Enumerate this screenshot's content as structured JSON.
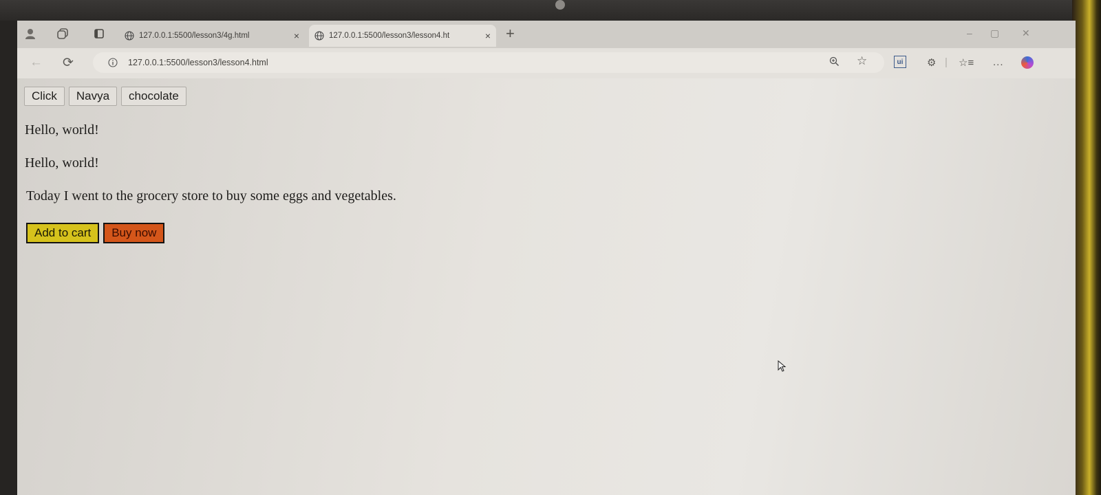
{
  "browser": {
    "tabs": [
      {
        "title": "127.0.0.1:5500/lesson3/4g.html",
        "close": "×"
      },
      {
        "title": "127.0.0.1:5500/lesson3/lesson4.ht",
        "close": "×"
      }
    ],
    "new_tab": "+",
    "address": {
      "url": "127.0.0.1:5500/lesson3/lesson4.html"
    },
    "extension_label": "ui",
    "menu": "..."
  },
  "page": {
    "buttons": [
      "Click",
      "Navya",
      "chocolate"
    ],
    "paragraphs": [
      "Hello, world!",
      "Hello, world!",
      "Today I went to the grocery store to buy some eggs and vegetables."
    ],
    "add_to_cart": "Add to cart",
    "buy_now": "Buy now"
  },
  "colors": {
    "add_to_cart_bg": "#d6c21c",
    "buy_now_bg": "#d4561a"
  },
  "icons": [
    "profile-icon",
    "workspaces-icon",
    "tab-actions-icon",
    "globe-icon",
    "refresh-icon",
    "info-icon",
    "zoom-icon",
    "favorite-star-icon",
    "extension-icon",
    "favorites-icon",
    "menu-icon",
    "copilot-icon",
    "mouse-cursor-icon"
  ]
}
